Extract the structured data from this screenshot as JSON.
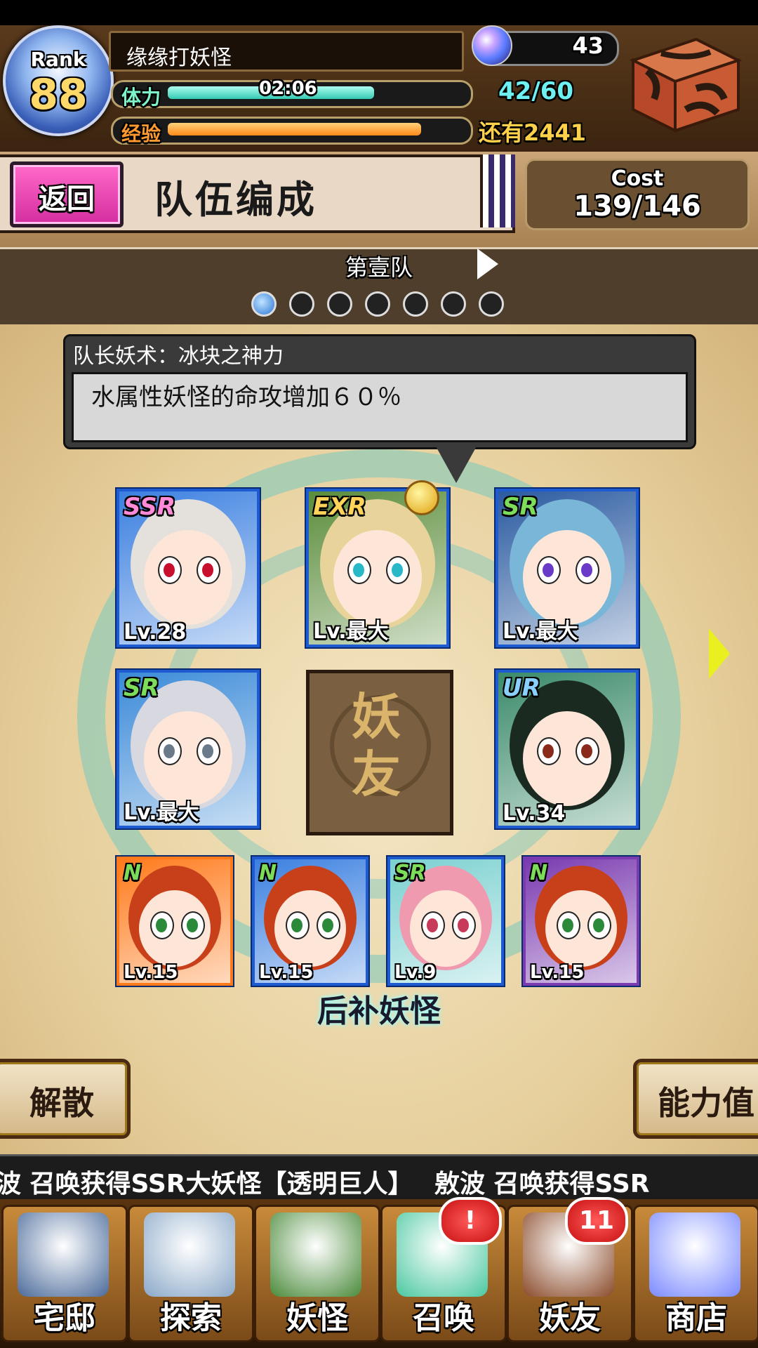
{
  "header": {
    "rank_label": "Rank",
    "rank_value": "88",
    "player_name": "缘缘打妖怪",
    "stamina_label": "体力",
    "stamina_timer": "02:06",
    "stamina_value": "42/60",
    "stamina_fraction": 0.7,
    "exp_label": "经验",
    "exp_remaining": "还有2441",
    "exp_fraction": 0.86,
    "gem_count": "43"
  },
  "title_row": {
    "back_label": "返回",
    "page_title": "队伍编成",
    "cost_label": "Cost",
    "cost_value": "139/146"
  },
  "team_selector": {
    "team_name": "第壹队",
    "page_count": 7,
    "active_index": 0
  },
  "leader_skill": {
    "title": "队长妖术：冰块之神力",
    "description": "水属性妖怪的命攻增加６０％"
  },
  "main_team": [
    {
      "rarity": "SSR",
      "level": "Lv.28",
      "rarity_color": "#ff8ad8",
      "iris": "#c8102e",
      "hair": "#e4e0dc",
      "bg": "#3a7fe0"
    },
    {
      "rarity": "EXR",
      "level": "Lv.最大",
      "rarity_color": "#ffd25a",
      "iris": "#28b8c8",
      "hair": "#e8d49a",
      "bg": "#5a8c3a",
      "leader": true
    },
    {
      "rarity": "SR",
      "level": "Lv.最大",
      "rarity_color": "#7ddc5a",
      "iris": "#6a3ac8",
      "hair": "#7ab6d8",
      "bg": "#2a5aa0"
    },
    {
      "rarity": "SR",
      "level": "Lv.最大",
      "rarity_color": "#7ddc5a",
      "iris": "#6a7a8a",
      "hair": "#d8d8e0",
      "bg": "#3a8ad8"
    },
    {
      "friend_slot": true,
      "label": "妖友"
    },
    {
      "rarity": "UR",
      "level": "Lv.34",
      "rarity_color": "#8ad0ff",
      "iris": "#8a2a1a",
      "hair": "#1a2a20",
      "bg": "#3a8a6a"
    }
  ],
  "reserve": {
    "label": "后补妖怪",
    "members": [
      {
        "rarity": "N",
        "level": "Lv.15",
        "rarity_color": "#7ddc5a",
        "iris": "#2a8a3a",
        "hair": "#c8401a",
        "bg": "#ff7a1a",
        "border": "#ff7a1a"
      },
      {
        "rarity": "N",
        "level": "Lv.15",
        "rarity_color": "#7ddc5a",
        "iris": "#2a8a3a",
        "hair": "#c8401a",
        "bg": "#3a7fe0",
        "border": "#1e5ad0"
      },
      {
        "rarity": "SR",
        "level": "Lv.9",
        "rarity_color": "#7ddc5a",
        "iris": "#c83a5a",
        "hair": "#f09ab0",
        "bg": "#7ad0d0",
        "border": "#1e5ad0"
      },
      {
        "rarity": "N",
        "level": "Lv.15",
        "rarity_color": "#7ddc5a",
        "iris": "#2a8a3a",
        "hair": "#c8401a",
        "bg": "#7a3ab0",
        "border": "#7a3ab0"
      }
    ]
  },
  "actions": {
    "disband_label": "解散",
    "stats_label": "能力值"
  },
  "ticker": {
    "text": "波 召唤获得SSR大妖怪【透明巨人】　 敫波 召唤获得SSR"
  },
  "nav": [
    {
      "label": "宅邸",
      "icon": "house-icon",
      "color": "#4a6a9a"
    },
    {
      "label": "探索",
      "icon": "magnifier-icon",
      "color": "#8aa8c8"
    },
    {
      "label": "妖怪",
      "icon": "scroll-icon",
      "color": "#4a8a3a"
    },
    {
      "label": "召唤",
      "icon": "pentagram-icon",
      "color": "#4ac8a0",
      "badge": "!"
    },
    {
      "label": "妖友",
      "icon": "friend-girl-icon",
      "color": "#8a4a2a",
      "badge": "11"
    },
    {
      "label": "商店",
      "icon": "crystal-orb-icon",
      "color": "#7a8aff"
    }
  ]
}
